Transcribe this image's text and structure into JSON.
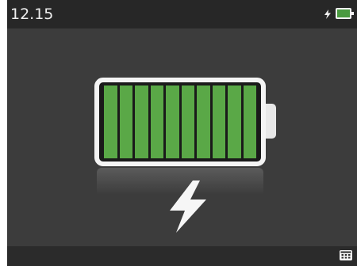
{
  "status_bar": {
    "time": "12.15",
    "charging_icon": "bolt-icon",
    "battery_icon": "battery-icon"
  },
  "battery": {
    "charge_fraction": 1.0,
    "cells_total": 10,
    "cells_filled": 10,
    "fill_color": "#5aa847"
  },
  "charging_indicator_icon": "lightning-bolt-icon",
  "bottom_bar": {
    "menu_icon": "grid-icon"
  }
}
